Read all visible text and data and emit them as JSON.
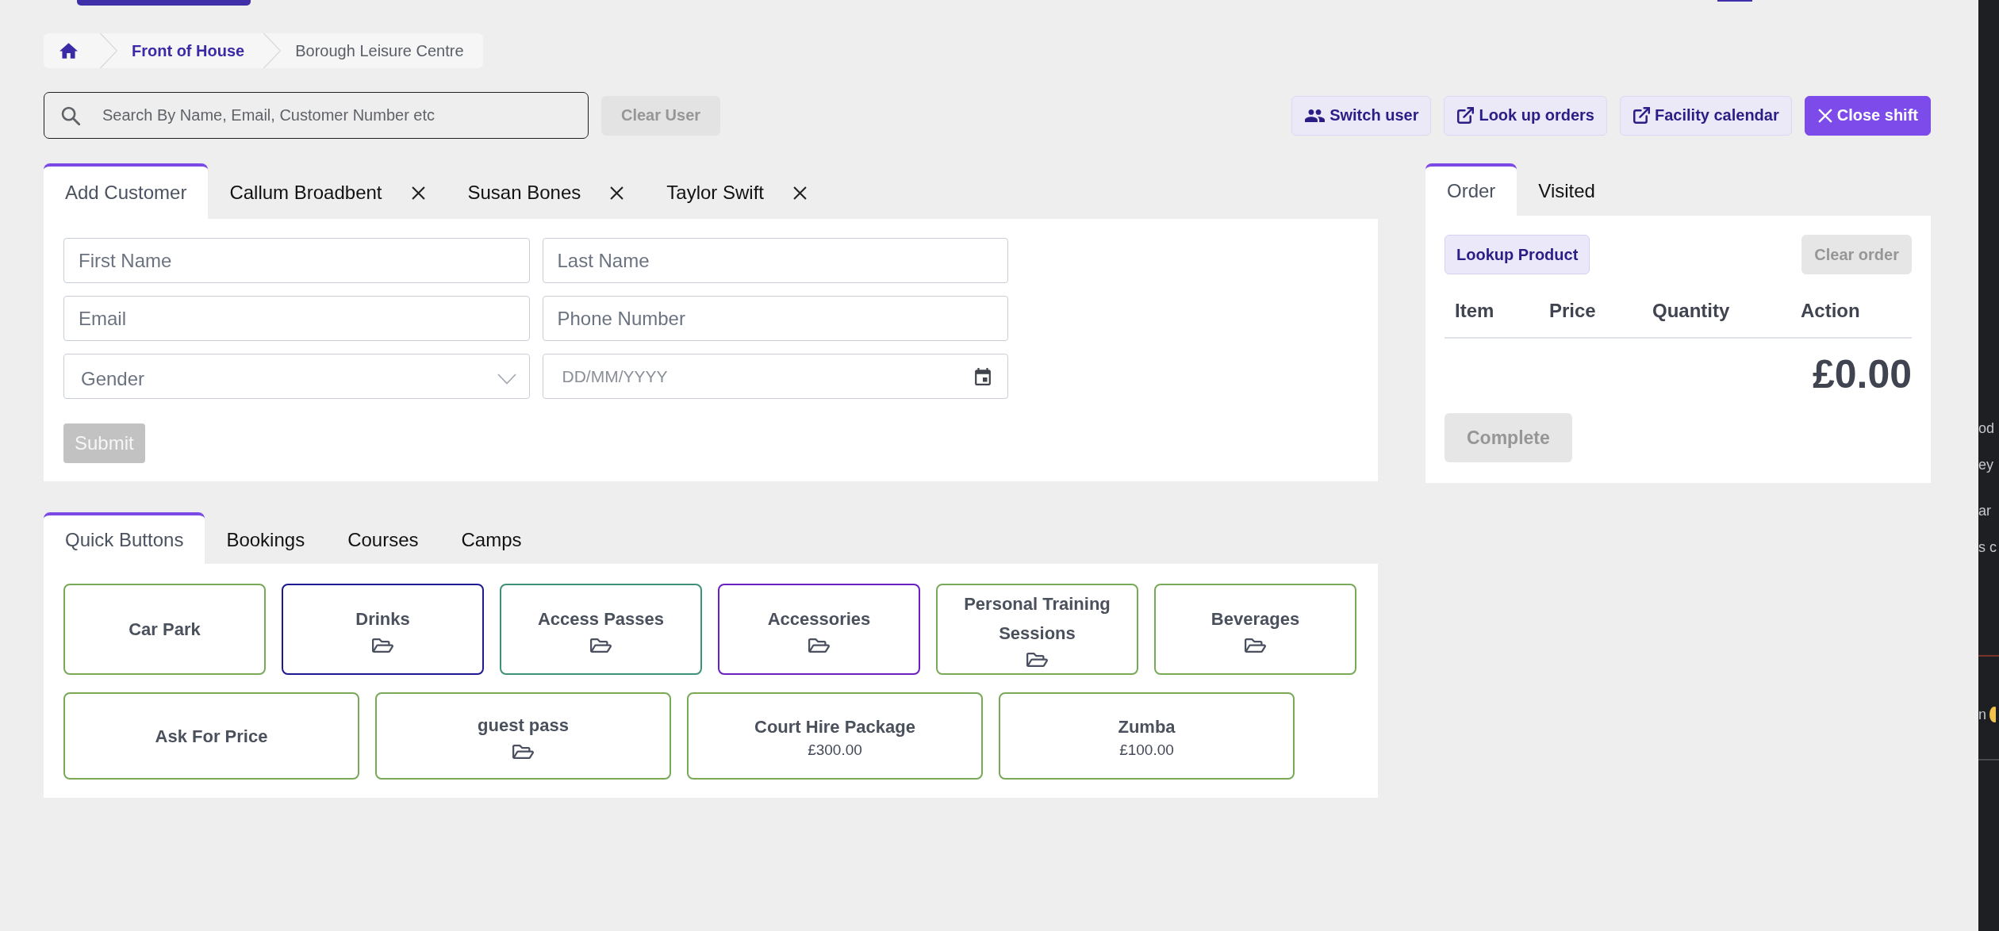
{
  "breadcrumb": [
    {
      "kind": "link",
      "label": "Front of House"
    },
    {
      "kind": "current",
      "label": "Borough Leisure Centre"
    }
  ],
  "search": {
    "placeholder": "Search By Name, Email, Customer Number etc"
  },
  "clear_user": {
    "label": "Clear User",
    "disabled": true
  },
  "actions": [
    {
      "kind": "switch",
      "label": "Switch user",
      "primary": false
    },
    {
      "kind": "external",
      "label": "Look up orders",
      "primary": false
    },
    {
      "kind": "external",
      "label": "Facility calendar",
      "primary": false
    },
    {
      "kind": "close",
      "label": "Close shift",
      "primary": true
    }
  ],
  "customer_tabs": [
    {
      "label": "Add Customer",
      "selected": true,
      "closable": false
    },
    {
      "label": "Callum Broadbent",
      "selected": false,
      "closable": true
    },
    {
      "label": "Susan Bones",
      "selected": false,
      "closable": true
    },
    {
      "label": "Taylor Swift",
      "selected": false,
      "closable": true
    }
  ],
  "customer_form": {
    "fields": [
      {
        "kind": "text",
        "placeholder": "First Name"
      },
      {
        "kind": "text",
        "placeholder": "Last Name"
      },
      {
        "kind": "text",
        "placeholder": "Email"
      },
      {
        "kind": "text",
        "placeholder": "Phone Number"
      },
      {
        "kind": "select",
        "placeholder": "Gender"
      },
      {
        "kind": "date",
        "placeholder": "DD/MM/YYYY"
      }
    ],
    "submit": {
      "label": "Submit",
      "disabled": true
    }
  },
  "order_tabs": [
    {
      "label": "Order",
      "selected": true
    },
    {
      "label": "Visited",
      "selected": false
    }
  ],
  "order": {
    "lookup": {
      "label": "Lookup Product",
      "disabled": false
    },
    "clear": {
      "label": "Clear order",
      "disabled": true
    },
    "columns": [
      "Item",
      "Price",
      "Quantity",
      "Action"
    ],
    "total": "£0.00",
    "complete": {
      "label": "Complete",
      "disabled": true
    }
  },
  "quick_tabs": [
    {
      "label": "Quick Buttons",
      "selected": true
    },
    {
      "label": "Bookings",
      "selected": false
    },
    {
      "label": "Courses",
      "selected": false
    },
    {
      "label": "Camps",
      "selected": false
    }
  ],
  "quick_buttons": [
    [
      {
        "label": "Car Park",
        "kind": "item",
        "color": "#78a957"
      },
      {
        "label": "Drinks",
        "kind": "folder",
        "color": "#1c1a8e"
      },
      {
        "label": "Access Passes",
        "kind": "folder",
        "color": "#3f9078"
      },
      {
        "label": "Accessories",
        "kind": "folder",
        "color": "#6c1fc1"
      },
      {
        "label": "Personal Training Sessions",
        "kind": "folder",
        "color": "#78a957"
      },
      {
        "label": "Beverages",
        "kind": "folder",
        "color": "#78a957"
      }
    ],
    [
      {
        "label": "Ask For Price",
        "kind": "item",
        "color": "#78a957"
      },
      {
        "label": "guest pass",
        "kind": "folder",
        "color": "#78a957"
      },
      {
        "label": "Court Hire Package",
        "kind": "product",
        "price": "£300.00",
        "color": "#78a957"
      },
      {
        "label": "Zumba",
        "kind": "product",
        "price": "£100.00",
        "color": "#78a957"
      }
    ]
  ],
  "side_window": {
    "paragraphs": [
      [
        "od",
        "ey"
      ],
      [
        "ar",
        "s c"
      ]
    ],
    "footer": "n"
  }
}
